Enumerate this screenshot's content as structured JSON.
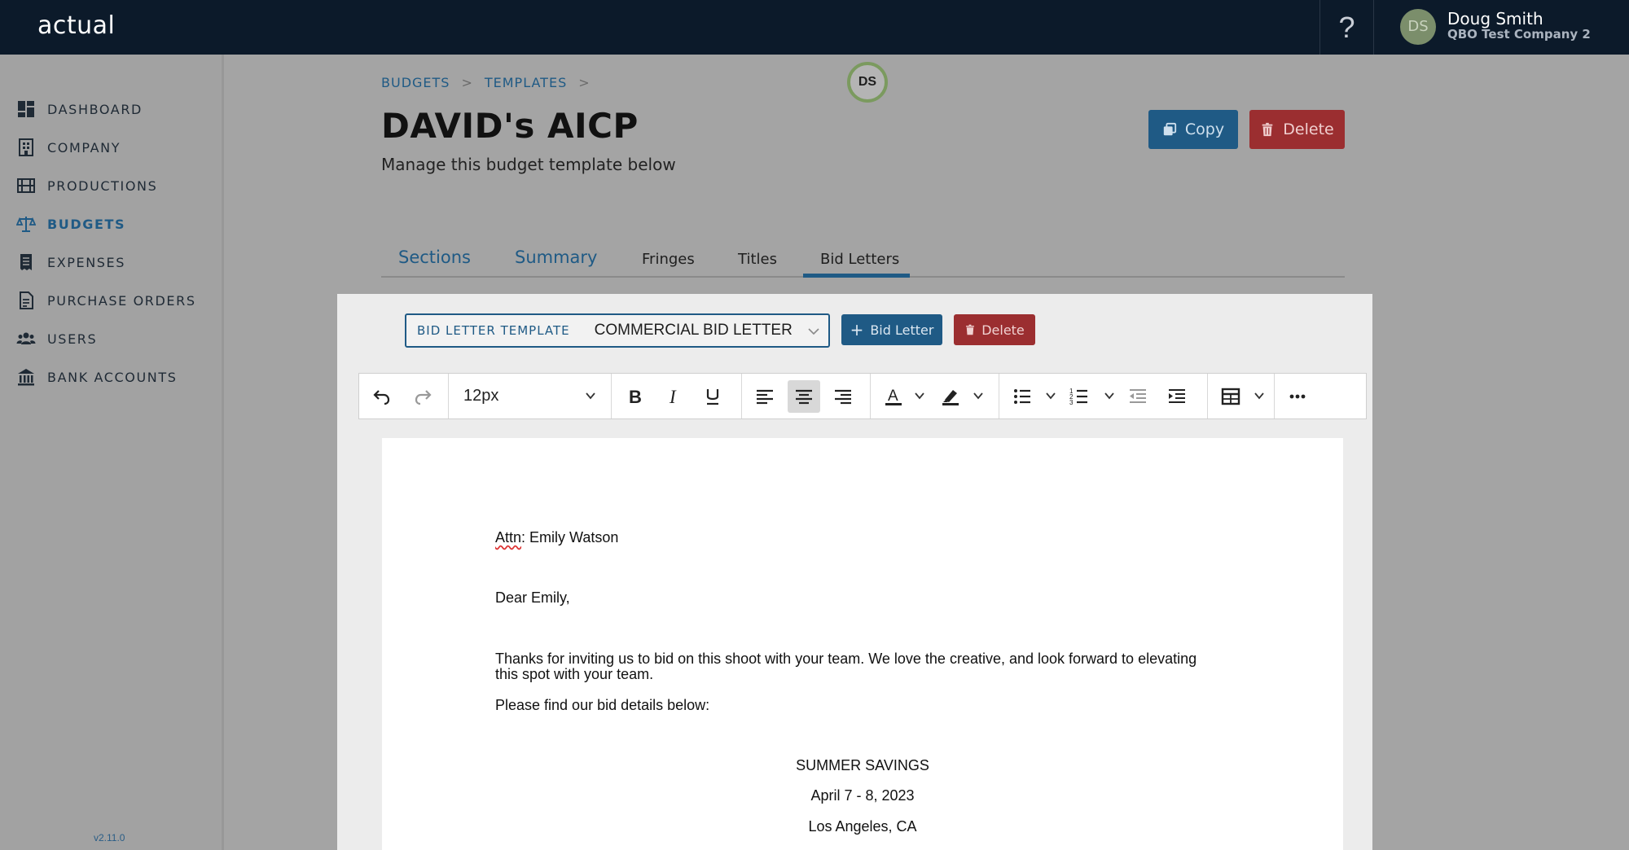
{
  "app": {
    "logo": "actual"
  },
  "header": {
    "help_label": "?",
    "user": {
      "initials": "DS",
      "name": "Doug Smith",
      "company": "QBO Test Company 2"
    }
  },
  "sidebar": {
    "items": [
      {
        "label": "DASHBOARD",
        "icon": "dashboard-icon",
        "active": false
      },
      {
        "label": "COMPANY",
        "icon": "building-icon",
        "active": false
      },
      {
        "label": "PRODUCTIONS",
        "icon": "film-icon",
        "active": false
      },
      {
        "label": "BUDGETS",
        "icon": "scale-icon",
        "active": true
      },
      {
        "label": "EXPENSES",
        "icon": "receipt-icon",
        "active": false
      },
      {
        "label": "PURCHASE ORDERS",
        "icon": "document-icon",
        "active": false
      },
      {
        "label": "USERS",
        "icon": "users-icon",
        "active": false
      },
      {
        "label": "BANK ACCOUNTS",
        "icon": "bank-icon",
        "active": false
      }
    ],
    "version": "v2.11.0"
  },
  "breadcrumb": {
    "items": [
      "BUDGETS",
      "TEMPLATES"
    ],
    "separator": ">"
  },
  "presence": {
    "initials": "DS"
  },
  "page": {
    "title": "DAVID's AICP",
    "subtitle": "Manage this budget template below",
    "copy_label": "Copy",
    "delete_label": "Delete"
  },
  "tabs": [
    {
      "label": "Sections",
      "active": false
    },
    {
      "label": "Summary",
      "active": false
    },
    {
      "label": "Fringes",
      "active": false
    },
    {
      "label": "Titles",
      "active": false
    },
    {
      "label": "Bid Letters",
      "active": true
    }
  ],
  "bid_letters": {
    "template_label": "BID LETTER TEMPLATE",
    "template_value": "COMMERCIAL BID LETTER",
    "add_label": "Bid Letter",
    "add_prefix": "+",
    "delete_label": "Delete"
  },
  "editor": {
    "font_size": "12px",
    "active_tool": "align-center",
    "lines": {
      "attn_prefix": "Attn",
      "attn_rest": ": Emily Watson",
      "greeting": "Dear Emily,",
      "body1_a": "Thanks for inviting us to bid on this shoot with your team. We love the creative, and look forward to elevating",
      "body1_b": "this spot with your team.",
      "body2": "Please find our bid details below:",
      "project": "SUMMER SAVINGS",
      "dates": "April 7 - 8, 2023",
      "location": "Los Angeles, CA"
    }
  },
  "colors": {
    "topbar": "#0c1a2a",
    "accent": "#1f5a85",
    "danger": "#9b2e30",
    "avatar": "#7b8e6b"
  }
}
